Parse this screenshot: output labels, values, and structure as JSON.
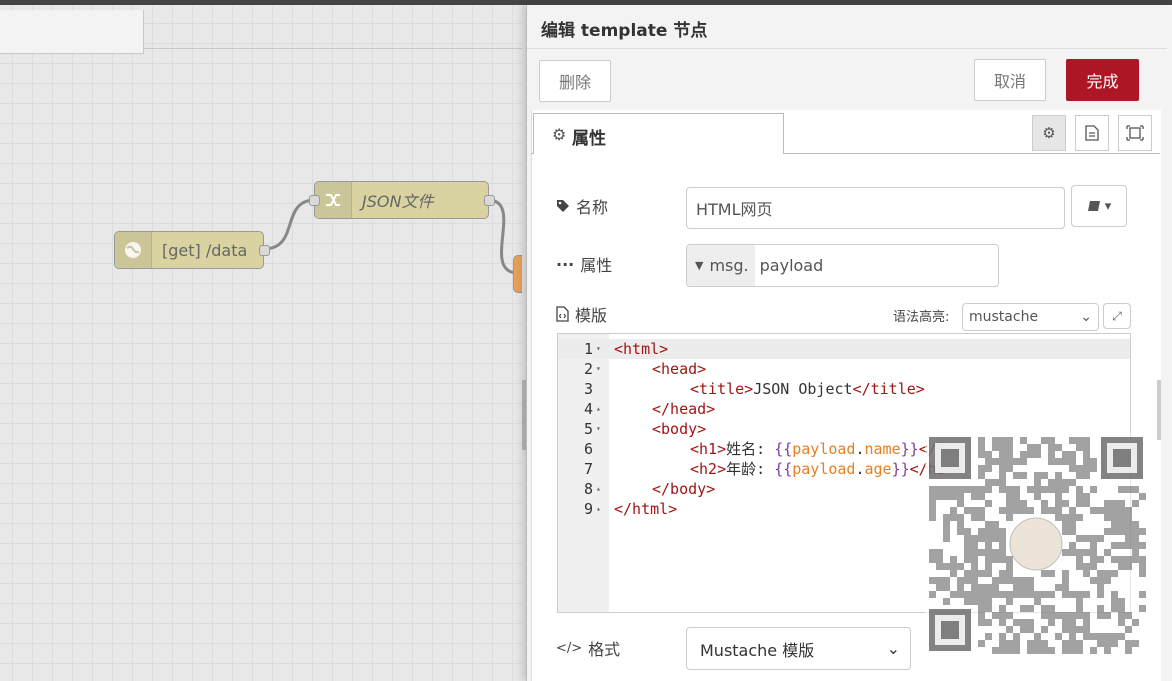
{
  "workspace": {
    "nodes": [
      {
        "label": "[get] /data",
        "icon": "globe-icon"
      },
      {
        "label": "JSON文件",
        "icon": "shuffle-icon"
      }
    ]
  },
  "tray": {
    "title": "编辑 template 节点",
    "buttons": {
      "delete": "删除",
      "cancel": "取消",
      "done": "完成"
    },
    "tabs": {
      "properties": "属性",
      "icons": [
        "gear-icon",
        "document-icon",
        "frame-icon"
      ]
    },
    "fields": {
      "name": {
        "label": "名称",
        "value": "HTML网页"
      },
      "property": {
        "label": "属性",
        "prefix": "msg.",
        "value": "payload"
      },
      "template": {
        "label": "模版",
        "syntax_label": "语法高亮:",
        "syntax_value": "mustache"
      },
      "format": {
        "label": "格式",
        "value": "Mustache 模版"
      }
    },
    "editor": {
      "lines": [
        {
          "n": "1",
          "fold": "▾"
        },
        {
          "n": "2",
          "fold": "▾"
        },
        {
          "n": "3",
          "fold": ""
        },
        {
          "n": "4",
          "fold": "▴"
        },
        {
          "n": "5",
          "fold": "▾"
        },
        {
          "n": "6",
          "fold": ""
        },
        {
          "n": "7",
          "fold": ""
        },
        {
          "n": "8",
          "fold": "▴"
        },
        {
          "n": "9",
          "fold": "▴"
        }
      ],
      "tokens": {
        "html_open": "<html>",
        "head_open": "<head>",
        "title_open": "<title>",
        "title_text": "JSON Object",
        "title_close": "</title>",
        "head_close": "</head>",
        "body_open": "<body>",
        "h1_open": "<h1>",
        "h1_text": "姓名: ",
        "h1_close": "</h1>",
        "h2_open": "<h2>",
        "h2_text": "年龄: ",
        "h2_close": "</h2>",
        "body_close": "</body>",
        "html_close": "</html>",
        "mo": "{{",
        "mc": "}}",
        "payload": "payload",
        "dot": ".",
        "name": "name",
        "age": "age"
      }
    }
  },
  "colors": {
    "accent": "#ad1625",
    "tag": "#a31515",
    "mustache": "#7a3e9d",
    "variable": "#e67e22"
  }
}
